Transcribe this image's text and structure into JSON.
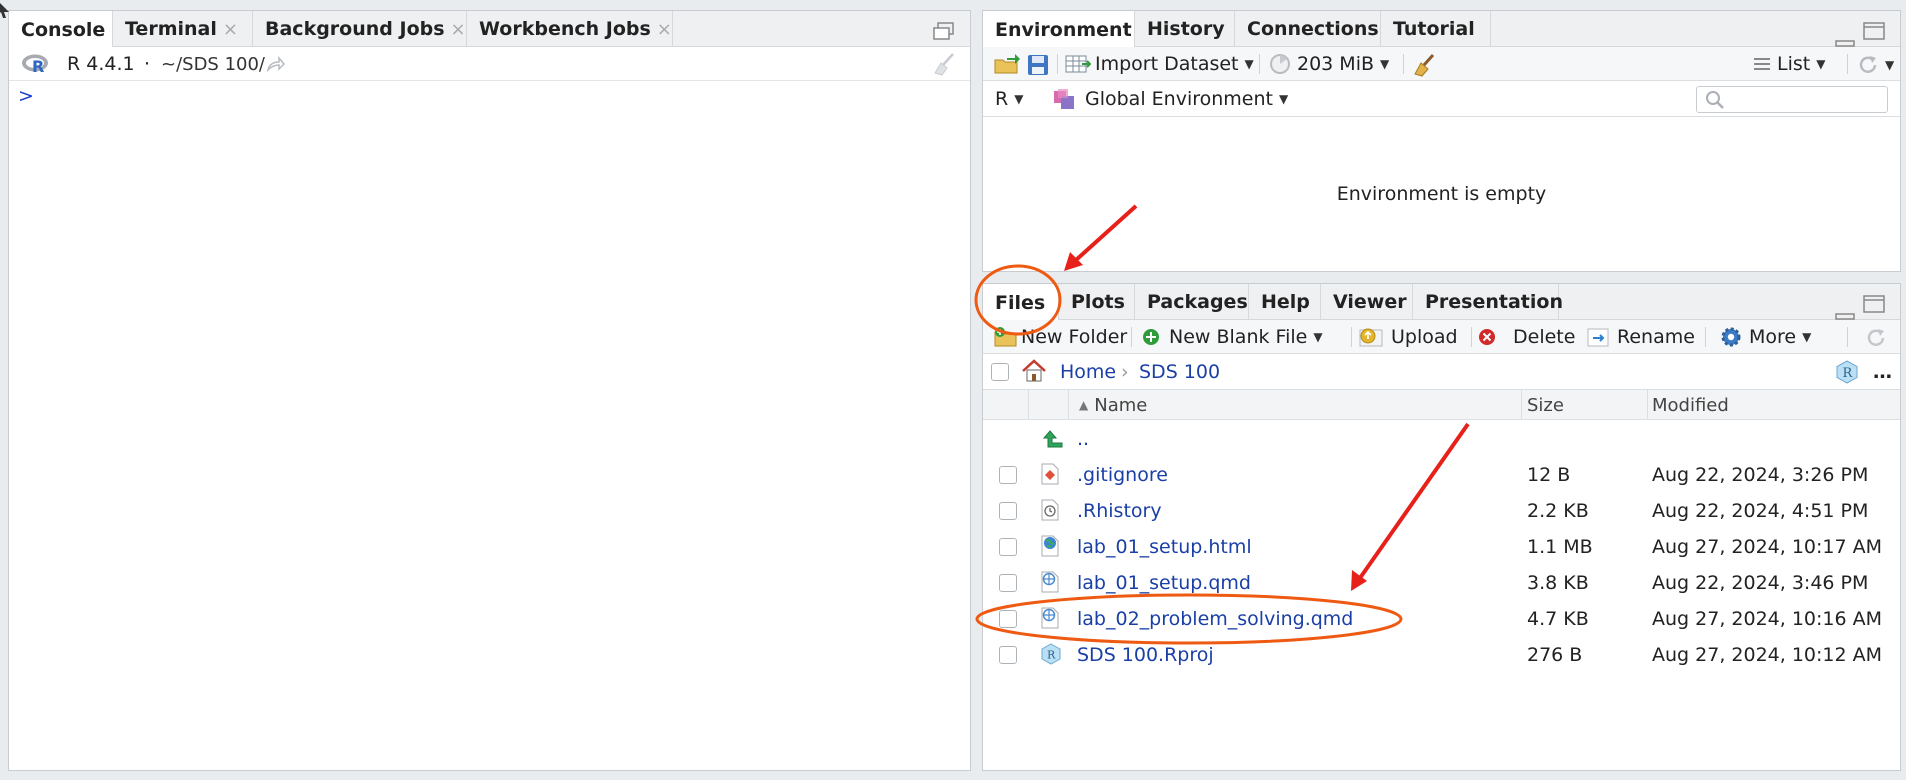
{
  "left": {
    "tabs": [
      {
        "label": "Console",
        "closable": false,
        "active": true
      },
      {
        "label": "Terminal",
        "closable": true
      },
      {
        "label": "Background Jobs",
        "closable": true
      },
      {
        "label": "Workbench Jobs",
        "closable": true
      }
    ],
    "close_glyph": "×",
    "version": "R 4.4.1",
    "dot": "·",
    "path": "~/SDS 100/",
    "prompt": ">"
  },
  "env": {
    "tabs": [
      "Environment",
      "History",
      "Connections",
      "Tutorial"
    ],
    "import_dataset": "Import Dataset",
    "memory": "203 MiB",
    "list_label": "List",
    "lang": "R",
    "global_env": "Global Environment",
    "search_placeholder": "",
    "empty_message": "Environment is empty"
  },
  "files": {
    "tabs": [
      "Files",
      "Plots",
      "Packages",
      "Help",
      "Viewer",
      "Presentation"
    ],
    "toolbar": {
      "new_folder": "New Folder",
      "new_blank_file": "New Blank File",
      "upload": "Upload",
      "delete": "Delete",
      "rename": "Rename",
      "more": "More"
    },
    "breadcrumb": {
      "home": "Home",
      "sep": "›",
      "folder": "SDS 100"
    },
    "ellipsis": "…",
    "columns": {
      "name": "Name",
      "size": "Size",
      "modified": "Modified"
    },
    "parent": "..",
    "rows": [
      {
        "name": ".gitignore",
        "size": "12 B",
        "modified": "Aug 22, 2024, 3:26 PM",
        "icon": "git-file-icon"
      },
      {
        "name": ".Rhistory",
        "size": "2.2 KB",
        "modified": "Aug 22, 2024, 4:51 PM",
        "icon": "history-file-icon"
      },
      {
        "name": "lab_01_setup.html",
        "size": "1.1 MB",
        "modified": "Aug 27, 2024, 10:17 AM",
        "icon": "html-file-icon"
      },
      {
        "name": "lab_01_setup.qmd",
        "size": "3.8 KB",
        "modified": "Aug 22, 2024, 3:46 PM",
        "icon": "quarto-file-icon"
      },
      {
        "name": "lab_02_problem_solving.qmd",
        "size": "4.7 KB",
        "modified": "Aug 27, 2024, 10:16 AM",
        "icon": "quarto-file-icon"
      },
      {
        "name": "SDS 100.Rproj",
        "size": "276 B",
        "modified": "Aug 27, 2024, 10:12 AM",
        "icon": "rproj-file-icon"
      }
    ]
  },
  "colors": {
    "accent_link": "#1a3fa6",
    "annotation_arrow": "#e8201a",
    "annotation_circle": "#ef5a12"
  }
}
